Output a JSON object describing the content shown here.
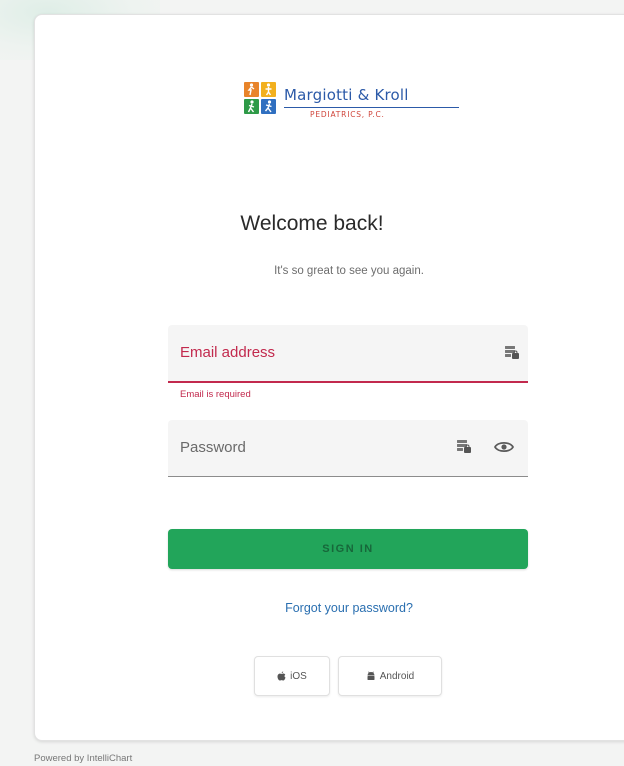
{
  "brand": {
    "name": "Margiotti & Kroll",
    "subtitle": "PEDIATRICS, P.C.",
    "colors": {
      "blue": "#2c5aa8",
      "red": "#d0453b",
      "orange": "#e8842a",
      "yellow": "#f2b01e",
      "green": "#2e9a47",
      "square_blue": "#2f6fc0"
    }
  },
  "heading": {
    "title": "Welcome back!",
    "subtitle": "It's so great to see you again."
  },
  "email_field": {
    "placeholder": "Email address",
    "value": "",
    "error": "Email is required",
    "icon": "password-manager-key-icon"
  },
  "password_field": {
    "placeholder": "Password",
    "value": "",
    "icon": "password-manager-key-icon",
    "toggle_icon": "eye-icon"
  },
  "actions": {
    "sign_in": "SIGN IN",
    "forgot_password": "Forgot your password?"
  },
  "apps": {
    "ios": "iOS",
    "android": "Android"
  },
  "footer": {
    "powered_by": "Powered by IntelliChart"
  },
  "colors": {
    "accent_green": "#22a55a",
    "error_red": "#c2294d",
    "link_blue": "#2a6fb0"
  }
}
